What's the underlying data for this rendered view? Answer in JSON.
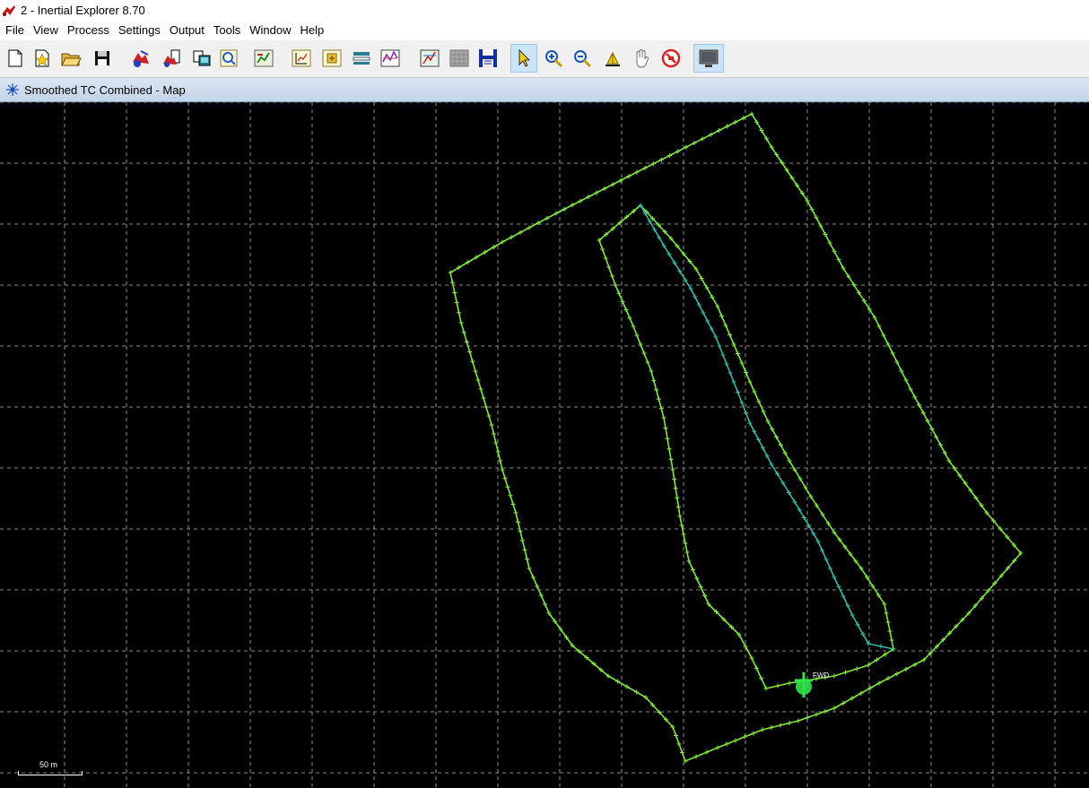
{
  "window": {
    "title": "2 - Inertial Explorer 8.70"
  },
  "menu": [
    "File",
    "View",
    "Process",
    "Settings",
    "Output",
    "Tools",
    "Window",
    "Help"
  ],
  "toolbar": {
    "buttons": [
      {
        "icon": "new-file-icon"
      },
      {
        "icon": "open-project-icon"
      },
      {
        "icon": "open-folder-icon"
      },
      {
        "icon": "save-icon"
      },
      {
        "icon": "process-gnss-icon"
      },
      {
        "icon": "process-tc-icon"
      },
      {
        "icon": "combine-icon"
      },
      {
        "icon": "compute-icon"
      },
      {
        "icon": "plot-icon"
      },
      {
        "icon": "export-icon"
      },
      {
        "icon": "output-icon"
      },
      {
        "icon": "list-icon"
      },
      {
        "icon": "grid-plot-icon"
      },
      {
        "icon": "map-plot-icon"
      },
      {
        "icon": "grey-plot-icon"
      },
      {
        "icon": "disk-icon"
      },
      {
        "icon": "select-cursor-icon"
      },
      {
        "icon": "zoom-in-icon"
      },
      {
        "icon": "zoom-out-icon"
      },
      {
        "icon": "measure-icon"
      },
      {
        "icon": "pan-hand-icon"
      },
      {
        "icon": "no-entry-icon"
      },
      {
        "icon": "monitor-icon"
      }
    ]
  },
  "map_window": {
    "title": "Smoothed TC Combined - Map",
    "scale_label": "50 m",
    "marker_label": "FWD",
    "colors": {
      "background": "#000000",
      "grid": "#b4b4b4",
      "track": "#7fe83a",
      "track_alt": "#33b8a8",
      "marker": "#2fe64a"
    }
  }
}
